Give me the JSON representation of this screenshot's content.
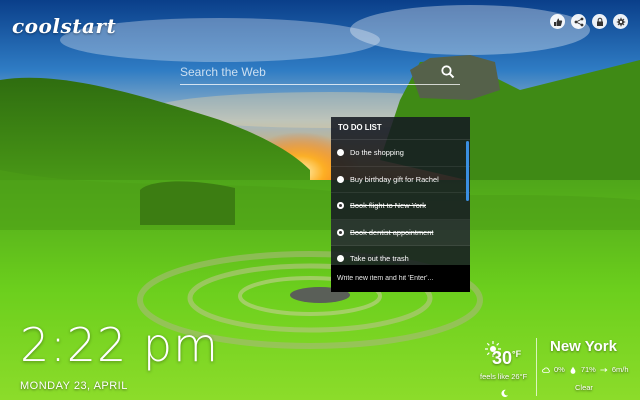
{
  "app": {
    "logo": "coolstart"
  },
  "top_icons": [
    "like-icon",
    "share-icon",
    "lock-icon",
    "settings-icon"
  ],
  "search": {
    "placeholder": "Search the Web"
  },
  "todo": {
    "title": "TO DO LIST",
    "items": [
      {
        "label": "Do the shopping",
        "done": false
      },
      {
        "label": "Buy birthday gift for Rachel",
        "done": false
      },
      {
        "label": "Book flight to New York",
        "done": true
      },
      {
        "label": "Book dentist appointment",
        "done": true
      },
      {
        "label": "Take out the trash",
        "done": false
      }
    ],
    "new_placeholder": "Write new item and hit 'Enter'..."
  },
  "clock": {
    "time": "2:22 pm",
    "date": "MONDAY 23, APRIL"
  },
  "weather": {
    "temp": "30",
    "unit": "°F",
    "feels_like": "feels like 26°F",
    "city": "New York",
    "cloud": "0%",
    "humidity": "71%",
    "wind": "6m/h",
    "condition": "Clear"
  },
  "colors": {
    "accent": "#3b8fe0",
    "panel": "#161a22"
  }
}
